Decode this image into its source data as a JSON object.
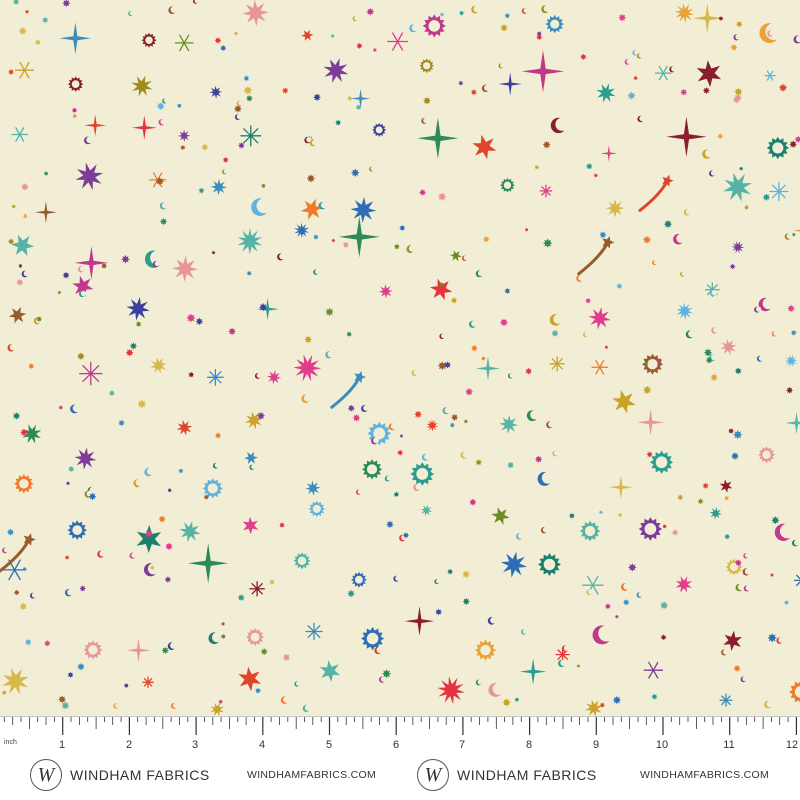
{
  "fabric": {
    "background": "#f1eed5",
    "palette": [
      "#e6323c",
      "#e0442a",
      "#f07a2a",
      "#e9a23a",
      "#c9a227",
      "#a08a1e",
      "#6b8e23",
      "#2e8b57",
      "#1d7f6e",
      "#2a9d8f",
      "#3c8dbc",
      "#2f6db5",
      "#3b3f9e",
      "#7d3c98",
      "#c0398b",
      "#e03e8c",
      "#8b1e2d",
      "#9a5b2c",
      "#d7b84a",
      "#56b3a6",
      "#e8959a",
      "#5fb3e0"
    ],
    "motif_icons": [
      "starburst-icon",
      "four-point-star-icon",
      "sun-icon",
      "snowflake-icon",
      "crescent-moon-icon",
      "shooting-star-icon",
      "dot-icon"
    ]
  },
  "ruler": {
    "unit_label": "inch",
    "numbers": [
      "1",
      "2",
      "3",
      "4",
      "5",
      "6",
      "7",
      "8",
      "9",
      "10",
      "11",
      "12"
    ],
    "brand_name_1": "WINDHAM FABRICS",
    "url_1": "WINDHAMFABRICS.COM",
    "brand_name_2": "WINDHAM FABRICS",
    "url_2": "WINDHAMFABRICS.COM",
    "logo_letter": "W"
  }
}
